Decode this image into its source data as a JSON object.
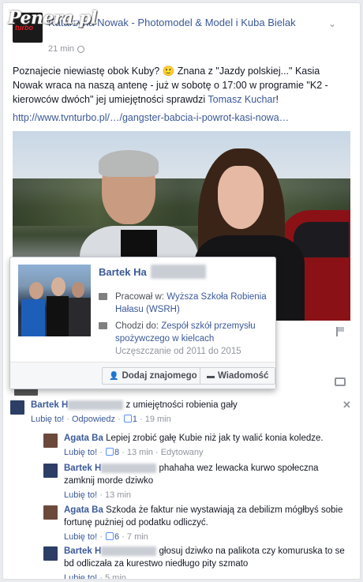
{
  "watermark": "Penera.pl",
  "post": {
    "title": "Katarzyna Nowak - Photomodel & Model i Kuba Bielak",
    "time": "21 min",
    "text_before_mention": "Poznajecie niewiastę obok Kuby? 🙂 Znana z \"Jazdy polskiej...\" Kasia Nowak wraca na naszą antenę - już w sobotę o 17:00 w programie \"K2 - kierowców dwóch\" jej umiejętności sprawdzi ",
    "mention": "Tomasz Kuchar",
    "text_after_mention": "!",
    "link": "http://www.tvnturbo.pl/…/gangster-babcia-i-powrot-kasi-nowa…"
  },
  "hovercard": {
    "name": "Bartek Ha",
    "work_prefix": "Pracował w: ",
    "work_place": "Wyższa Szkoła Robienia Hałasu (WSRH)",
    "school_prefix": "Chodzi do: ",
    "school_place": "Zespół szkół przemysłu spożywczego w kielcach",
    "school_years": "Uczęszczanie od 2011 do 2015",
    "add_friend": "Dodaj znajomego",
    "message": "Wiadomość"
  },
  "comments": [
    {
      "author": "Bartek H",
      "text": "z umiejętności robienia gały",
      "like": "Lubię to!",
      "reply": "Odpowiedz",
      "likes": "1",
      "time": "19 min"
    },
    {
      "author": "Agata Ba",
      "text": "Lepiej zrobić gałę Kubie niż jak ty walić konia koledze.",
      "like": "Lubię to!",
      "likes": "8",
      "time": "13 min",
      "edited": "Edytowany"
    },
    {
      "author": "Bartek H",
      "text": "phahaha wez lewacka kurwo społeczna zamknij morde dziwko",
      "like": "Lubię to!",
      "time": "13 min"
    },
    {
      "author": "Agata Ba",
      "text": "Szkoda że faktur nie wystawiają za debilizm mógłbyś sobie fortunę pużniej od podatku odliczyć.",
      "like": "Lubię to!",
      "likes": "6",
      "time": "7 min"
    },
    {
      "author": "Bartek H",
      "text": "głosuj dziwko na palikota czy komuruska to se bd odliczała za kurestwo niedługo pity szmato",
      "like": "Lubię to!",
      "time": "5 min"
    }
  ]
}
